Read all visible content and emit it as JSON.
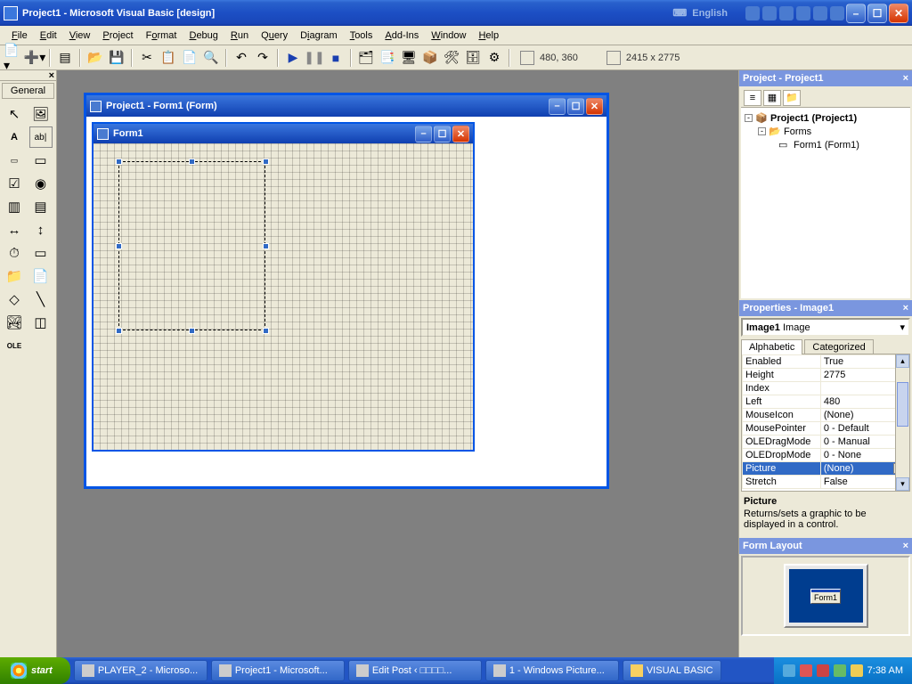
{
  "app": {
    "title": "Project1 - Microsoft Visual Basic [design]"
  },
  "titlebar_extras": {
    "language": "English"
  },
  "menu": [
    "File",
    "Edit",
    "View",
    "Project",
    "Format",
    "Debug",
    "Run",
    "Query",
    "Diagram",
    "Tools",
    "Add-Ins",
    "Window",
    "Help"
  ],
  "toolbar_coords": {
    "pos": "480, 360",
    "size": "2415 x 2775"
  },
  "toolbox": {
    "title": "General",
    "close_glyph": "×"
  },
  "designer": {
    "outer_title": "Project1 - Form1 (Form)",
    "form_title": "Form1"
  },
  "project_panel": {
    "title": "Project - Project1",
    "tree": {
      "root": "Project1 (Project1)",
      "folder": "Forms",
      "form": "Form1 (Form1)"
    }
  },
  "properties_panel": {
    "title": "Properties - Image1",
    "object": "Image1",
    "object_type": "Image",
    "tabs": [
      "Alphabetic",
      "Categorized"
    ],
    "rows": [
      {
        "name": "Enabled",
        "value": "True"
      },
      {
        "name": "Height",
        "value": "2775"
      },
      {
        "name": "Index",
        "value": ""
      },
      {
        "name": "Left",
        "value": "480"
      },
      {
        "name": "MouseIcon",
        "value": "(None)"
      },
      {
        "name": "MousePointer",
        "value": "0 - Default"
      },
      {
        "name": "OLEDragMode",
        "value": "0 - Manual"
      },
      {
        "name": "OLEDropMode",
        "value": "0 - None"
      },
      {
        "name": "Picture",
        "value": "(None)",
        "selected": true,
        "ellipsis": true
      },
      {
        "name": "Stretch",
        "value": "False"
      }
    ],
    "desc_title": "Picture",
    "desc_text": "Returns/sets a graphic to be displayed in a control."
  },
  "formlayout_panel": {
    "title": "Form Layout",
    "mini_label": "Form1"
  },
  "taskbar": {
    "start": "start",
    "tasks": [
      "PLAYER_2 - Microso...",
      "Project1 - Microsoft...",
      "Edit Post ‹ □□□□...",
      "1 - Windows Picture...",
      "VISUAL BASIC"
    ],
    "clock": "7:38 AM"
  }
}
